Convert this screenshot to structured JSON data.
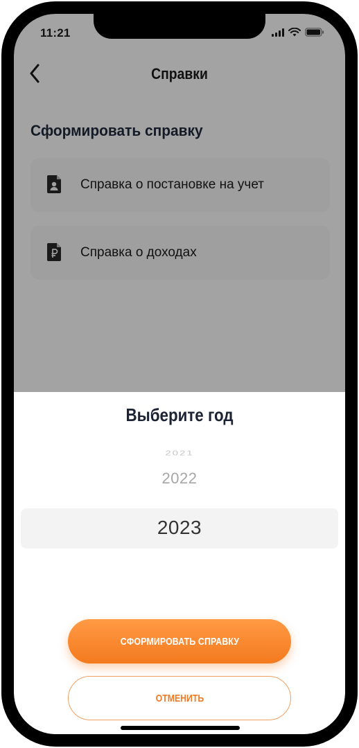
{
  "status_bar": {
    "time": "11:21"
  },
  "header": {
    "title": "Справки"
  },
  "section": {
    "title": "Сформировать справку"
  },
  "documents": [
    {
      "label": "Справка о постановке на учет",
      "icon": "person-document-icon"
    },
    {
      "label": "Справка о доходах",
      "icon": "ruble-document-icon"
    }
  ],
  "sheet": {
    "title": "Выберите год",
    "years": {
      "far": "2021",
      "near": "2022",
      "selected": "2023"
    },
    "primary_button": "СФОРМИРОВАТЬ СПРАВКУ",
    "secondary_button": "ОТМЕНИТЬ"
  },
  "colors": {
    "accent": "#f47a1e",
    "overlay": "#a3a3a3",
    "text_dark": "#1c2433"
  }
}
